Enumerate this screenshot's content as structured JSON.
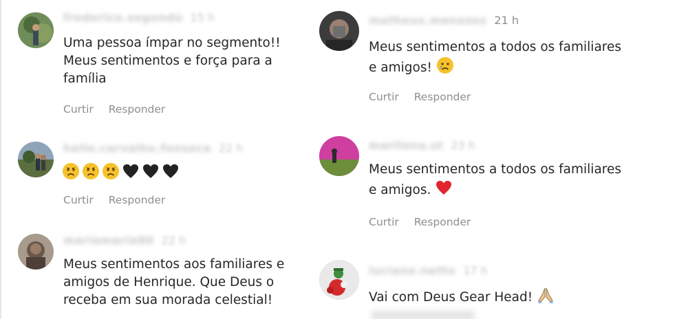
{
  "actions": {
    "like_label": "Curtir",
    "reply_label": "Responder"
  },
  "left_comments": [
    {
      "username": "frederico.segundo",
      "time": "15 h",
      "lines": [
        "Uma pessoa ímpar no segmento!!",
        "Meus sentimentos e força para a",
        "família"
      ]
    },
    {
      "username": "helio.carvalho.fonseca",
      "time": "22 h",
      "emojis": [
        "sad-face",
        "sad-face",
        "sad-face",
        "black-heart",
        "black-heart",
        "black-heart"
      ]
    },
    {
      "username": "mariamaria80",
      "time": "22 h",
      "lines": [
        "Meus sentimentos aos familiares e",
        "amigos de Henrique. Que Deus o",
        "receba em sua morada celestial!"
      ]
    }
  ],
  "right_comments": [
    {
      "username": "matheus.menezes",
      "time": "21 h",
      "lines": [
        "Meus sentimentos a todos os familiares",
        "e amigos!"
      ],
      "trailing_emoji": "crying-face"
    },
    {
      "username": "marilena.st",
      "time": "23 h",
      "lines": [
        "Meus sentimentos a todos os familiares",
        "e amigos."
      ],
      "trailing_emoji": "red-heart"
    },
    {
      "username": "luciano.netto",
      "time": "17 h",
      "lines": [
        "Vai com Deus Gear Head!"
      ],
      "trailing_emoji": "folded-hands"
    }
  ],
  "colors": {
    "text": "#262626",
    "secondary": "#8e8e8e",
    "heart_red": "#e0252e",
    "emoji_yellow": "#f6c12b"
  }
}
